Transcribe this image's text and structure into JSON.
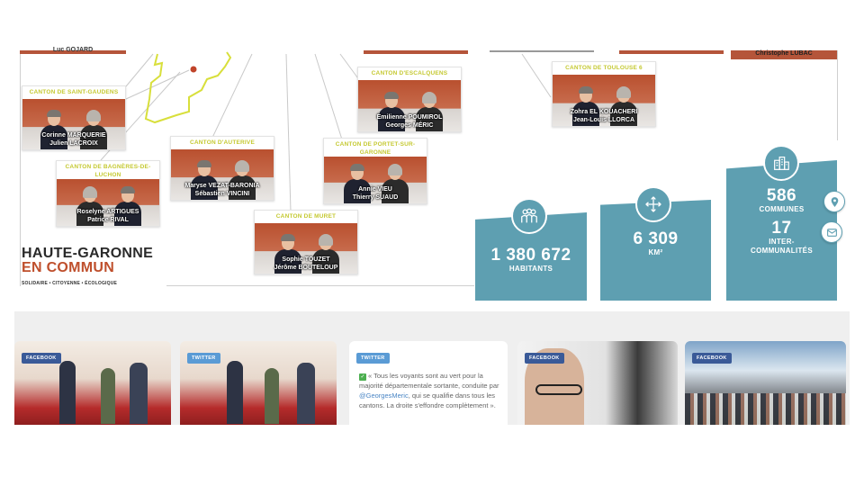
{
  "top_labels": {
    "left_name": "Luc GOJARD",
    "right_name": "Christophe LUBAC"
  },
  "cantons": [
    {
      "id": "saint-gaudens",
      "title": "CANTON DE SAINT-GAUDENS",
      "names": [
        "Corinne MARQUERIE",
        "Julien LACROIX"
      ]
    },
    {
      "id": "bagneres",
      "title": "CANTON DE BAGNÈRES-DE-LUCHON",
      "names": [
        "Roselyne ARTIGUES",
        "Patrice RIVAL"
      ]
    },
    {
      "id": "auterive",
      "title": "CANTON D'AUTERIVE",
      "names": [
        "Maryse VEZAT-BARONIA",
        "Sébastien VINCINI"
      ]
    },
    {
      "id": "muret",
      "title": "CANTON DE MURET",
      "names": [
        "Sophie TOUZET",
        "Jérôme BOUTELOUP"
      ]
    },
    {
      "id": "escalquens",
      "title": "CANTON D'ESCALQUENS",
      "names": [
        "Émilienne POUMIROL",
        "Georges MÉRIC"
      ]
    },
    {
      "id": "portet",
      "title": "CANTON DE PORTET-SUR-GARONNE",
      "names": [
        "Annie VIEU",
        "Thierry SUAUD"
      ]
    },
    {
      "id": "toulouse6",
      "title": "CANTON DE TOULOUSE 6",
      "names": [
        "Zohra EL KOUACHERI",
        "Jean-Louis LLORCA"
      ]
    }
  ],
  "logo": {
    "line1": "HAUTE-GARONNE",
    "line2": "EN COMMUN",
    "tagline": "SOLIDAIRE • CITOYENNE • ÉCOLOGIQUE"
  },
  "stats": [
    {
      "value": "1 380 672",
      "label": "HABITANTS",
      "icon": "people-icon"
    },
    {
      "value": "6 309",
      "label": "KM²",
      "icon": "area-arrows-icon"
    },
    {
      "value": "586",
      "label": "COMMUNES",
      "value2": "17",
      "label2": "INTER-\nCOMMUNALITÉS",
      "icon": "buildings-icon"
    }
  ],
  "side_buttons": [
    "location-pin-icon",
    "mail-icon"
  ],
  "social_posts": [
    {
      "network": "FACEBOOK",
      "kind": "photo"
    },
    {
      "network": "TWITTER",
      "kind": "photo"
    },
    {
      "network": "TWITTER",
      "kind": "text",
      "text_before": "« Tous les voyants sont au vert pour la majorité départementale sortante, conduite par ",
      "mention": "@GeorgesMeric",
      "text_after": ", qui se qualifie dans tous les cantons. La droite s'effondre complètement »."
    },
    {
      "network": "FACEBOOK",
      "kind": "photo"
    },
    {
      "network": "FACEBOOK",
      "kind": "photo"
    }
  ],
  "colors": {
    "accent_teal": "#5e9fb1",
    "brand_red": "#bf4f2c",
    "canton_title": "#c5c932",
    "facebook": "#3a5a98",
    "twitter": "#5a9bd5"
  }
}
